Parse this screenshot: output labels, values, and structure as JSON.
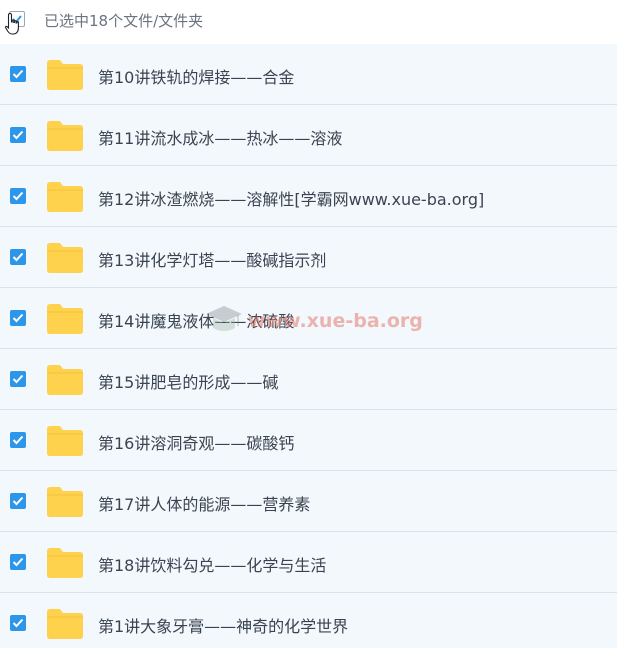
{
  "header": {
    "selection_text": "已选中18个文件/文件夹"
  },
  "rows": [
    {
      "name": "第10讲铁轨的焊接——合金"
    },
    {
      "name": "第11讲流水成冰——热冰——溶液"
    },
    {
      "name": "第12讲冰渣燃烧——溶解性[学霸网www.xue-ba.org]"
    },
    {
      "name": "第13讲化学灯塔——酸碱指示剂"
    },
    {
      "name": "第14讲魔鬼液体——浓硫酸"
    },
    {
      "name": "第15讲肥皂的形成——碱"
    },
    {
      "name": "第16讲溶洞奇观——碳酸钙"
    },
    {
      "name": "第17讲人体的能源——营养素"
    },
    {
      "name": "第18讲饮料勾兑——化学与生活"
    },
    {
      "name": "第1讲大象牙膏——神奇的化学世界"
    }
  ],
  "watermark": {
    "text": "www.xue-ba.org"
  },
  "colors": {
    "row_bg": "#f3f8fd",
    "row_border": "#d7e4f0",
    "checkbox_checked": "#2b96ea",
    "folder": "#ffd24d"
  },
  "icons": {
    "checkbox": "checkmark-icon",
    "folder": "folder-icon",
    "cursor": "hand-pointer-icon",
    "watermark": "graduation-cap-icon"
  }
}
